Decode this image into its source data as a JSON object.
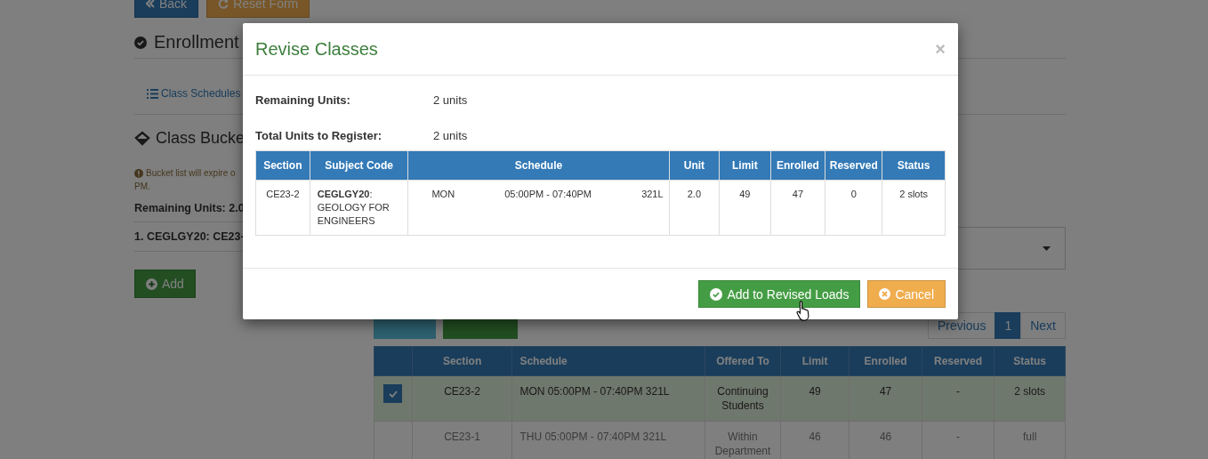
{
  "page": {
    "top_buttons": [
      {
        "label": "Back",
        "kind": "primary"
      },
      {
        "label": "Reset Form",
        "kind": "warning"
      }
    ],
    "heading": "Enrollment",
    "tab": "Class Schedules",
    "bucket": {
      "heading": "Class Bucke",
      "notice": [
        "Bucket list will expire o",
        "PM."
      ],
      "remaining": "Remaining Units: 2.0",
      "items": [
        "1. CEGLGY20: CE23-"
      ],
      "add_button": "Add"
    },
    "schedule": {
      "buttons": [
        {
          "kind": "info"
        },
        {
          "kind": "success"
        }
      ],
      "pagination": [
        {
          "label": "Previous",
          "selected": false
        },
        {
          "label": "1",
          "selected": true
        },
        {
          "label": "Next",
          "selected": false
        }
      ],
      "table": {
        "columns": [
          "Section",
          "Schedule",
          "Offered To",
          "Limit",
          "Enrolled",
          "Reserved",
          "Status"
        ],
        "rows": [
          {
            "checked": true,
            "selected": true,
            "disabled": false,
            "section": "CE23-2",
            "schedule": "MON 05:00PM - 07:40PM 321L",
            "offered_to": "Continuing Students",
            "limit": "49",
            "enrolled": "47",
            "reserved": "-",
            "status": "2 slots"
          },
          {
            "checked": false,
            "selected": false,
            "disabled": true,
            "section": "CE23-1",
            "schedule": "THU 05:00PM - 07:40PM 321L",
            "offered_to": "Within Department",
            "limit": "46",
            "enrolled": "46",
            "reserved": "-",
            "status": "full"
          }
        ]
      }
    }
  },
  "modal": {
    "title": "Revise Classes",
    "close": "×",
    "info": [
      {
        "label": "Remaining Units:",
        "value": "2 units"
      },
      {
        "label": "Total Units to Register:",
        "value": "2 units"
      }
    ],
    "table": {
      "columns": [
        "Section",
        "Subject Code",
        "Schedule",
        "Unit",
        "Limit",
        "Enrolled",
        "Reserved",
        "Status"
      ],
      "rows": [
        {
          "section": "CE23-2",
          "subject": "**CEGLGY20**: GEOLOGY FOR ENGINEERS",
          "day": "MON",
          "time": "05:00PM - 07:40PM",
          "room": "321L",
          "unit": "2.0",
          "limit": "49",
          "enrolled": "47",
          "reserved": "0",
          "status": "2 slots"
        }
      ]
    },
    "buttons": [
      {
        "label": "Add to Revised Loads",
        "kind": "success"
      },
      {
        "label": "Cancel",
        "kind": "warning"
      }
    ]
  }
}
